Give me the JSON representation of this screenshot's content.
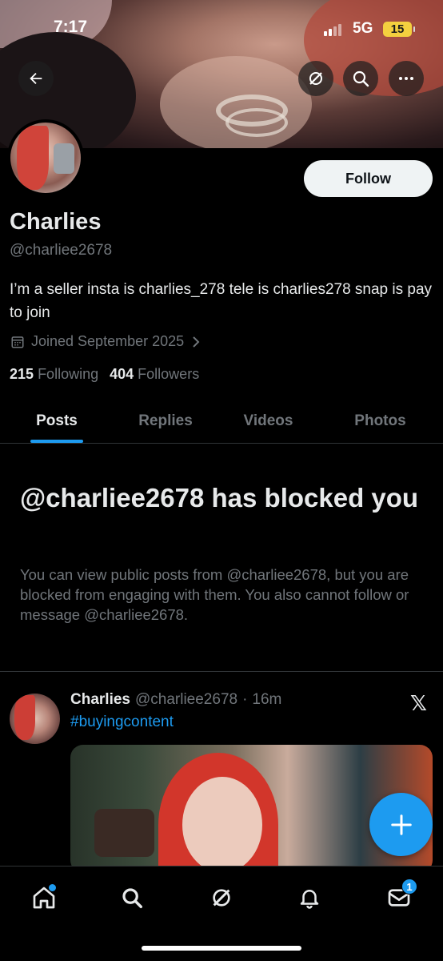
{
  "status_bar": {
    "time": "7:17",
    "network": "5G",
    "battery": "15"
  },
  "profile": {
    "name": "Charlies",
    "handle": "@charliee2678",
    "bio": "I’m a seller insta is charlies_278 tele is charlies278 snap is pay to join",
    "joined": "Joined September 2025",
    "following_count": "215",
    "following_label": "Following",
    "followers_count": "404",
    "followers_label": "Followers",
    "follow_label": "Follow"
  },
  "tabs": [
    {
      "label": "Posts",
      "active": true
    },
    {
      "label": "Replies"
    },
    {
      "label": "Videos"
    },
    {
      "label": "Photos"
    }
  ],
  "blocked": {
    "title": "@charliee2678 has blocked you",
    "text": "You can view public posts from @charliee2678, but you are blocked from engaging with them. You also cannot follow or message @charliee2678."
  },
  "post": {
    "name": "Charlies",
    "handle": "@charliee2678",
    "separator": "·",
    "time": "16m",
    "hashtag": "#buyingcontent",
    "platform_mark": "𝕏"
  },
  "nav": {
    "messages_badge": "1"
  },
  "colors": {
    "accent": "#1d9bf0",
    "background": "#000000",
    "secondary_text": "#71767b"
  },
  "icons": [
    "back-arrow-icon",
    "grok-icon",
    "search-icon",
    "more-icon",
    "calendar-icon",
    "chevron-right-icon",
    "x-logo-icon",
    "plus-icon",
    "home-icon",
    "bell-icon",
    "mail-icon"
  ]
}
